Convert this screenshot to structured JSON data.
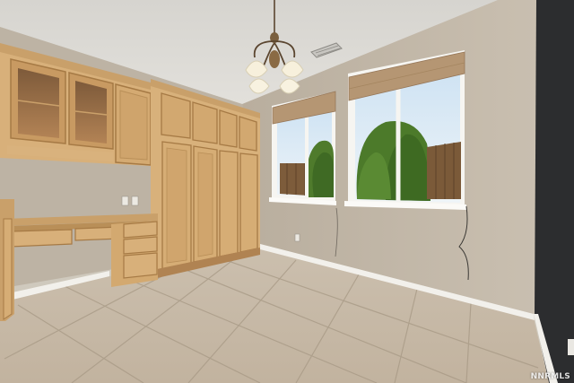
{
  "scene": {
    "watermark_text": "NNRMLS",
    "colors": {
      "ceiling": "#d9d7d2",
      "wall_left": "#bbb1a2",
      "wall_back": "#c3b8a9",
      "wall_right_dark": "#2c2d2f",
      "floor": "#c8bba8",
      "floor_grout": "#a89a86",
      "baseboard": "#f3f1ec",
      "cabinet_wood": "#d9b27d",
      "cabinet_wood_dark": "#b98f58",
      "window_frame": "#f7f6f2",
      "sky": "#d8e8f4",
      "trees": "#4f7d2f",
      "fence": "#7a5a3a",
      "blinds": "#b39673"
    },
    "icons": [
      "chandelier-icon",
      "ceiling-vent-icon",
      "outlet-icon"
    ]
  }
}
